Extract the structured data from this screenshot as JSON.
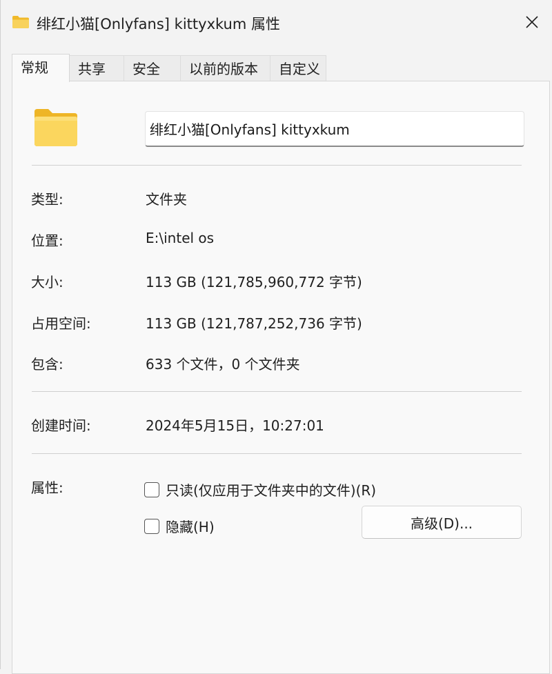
{
  "window": {
    "title": "绯红小猫[Onlyfans] kittyxkum 属性",
    "close_glyph": "✕",
    "folder_color": "#f5c842"
  },
  "tabs": [
    {
      "label": "常规",
      "active": true
    },
    {
      "label": "共享",
      "active": false
    },
    {
      "label": "安全",
      "active": false
    },
    {
      "label": "以前的版本",
      "active": false
    },
    {
      "label": "自定义",
      "active": false
    }
  ],
  "general": {
    "folder_name": "绯红小猫[Onlyfans] kittyxkum",
    "type_label": "类型:",
    "type_value": "文件夹",
    "location_label": "位置:",
    "location_value": "E:\\intel os",
    "size_label": "大小:",
    "size_value": "113 GB (121,785,960,772 字节)",
    "disk_size_label": "占用空间:",
    "disk_size_value": "113 GB (121,787,252,736 字节)",
    "contains_label": "包含:",
    "contains_value": "633 个文件，0 个文件夹",
    "created_label": "创建时间:",
    "created_value": "2024年5月15日，10:27:01",
    "attributes_label": "属性:",
    "readonly_label": "只读(仅应用于文件夹中的文件)(R)",
    "readonly_checked": false,
    "hidden_label": "隐藏(H)",
    "hidden_checked": false,
    "advanced_button": "高级(D)..."
  }
}
